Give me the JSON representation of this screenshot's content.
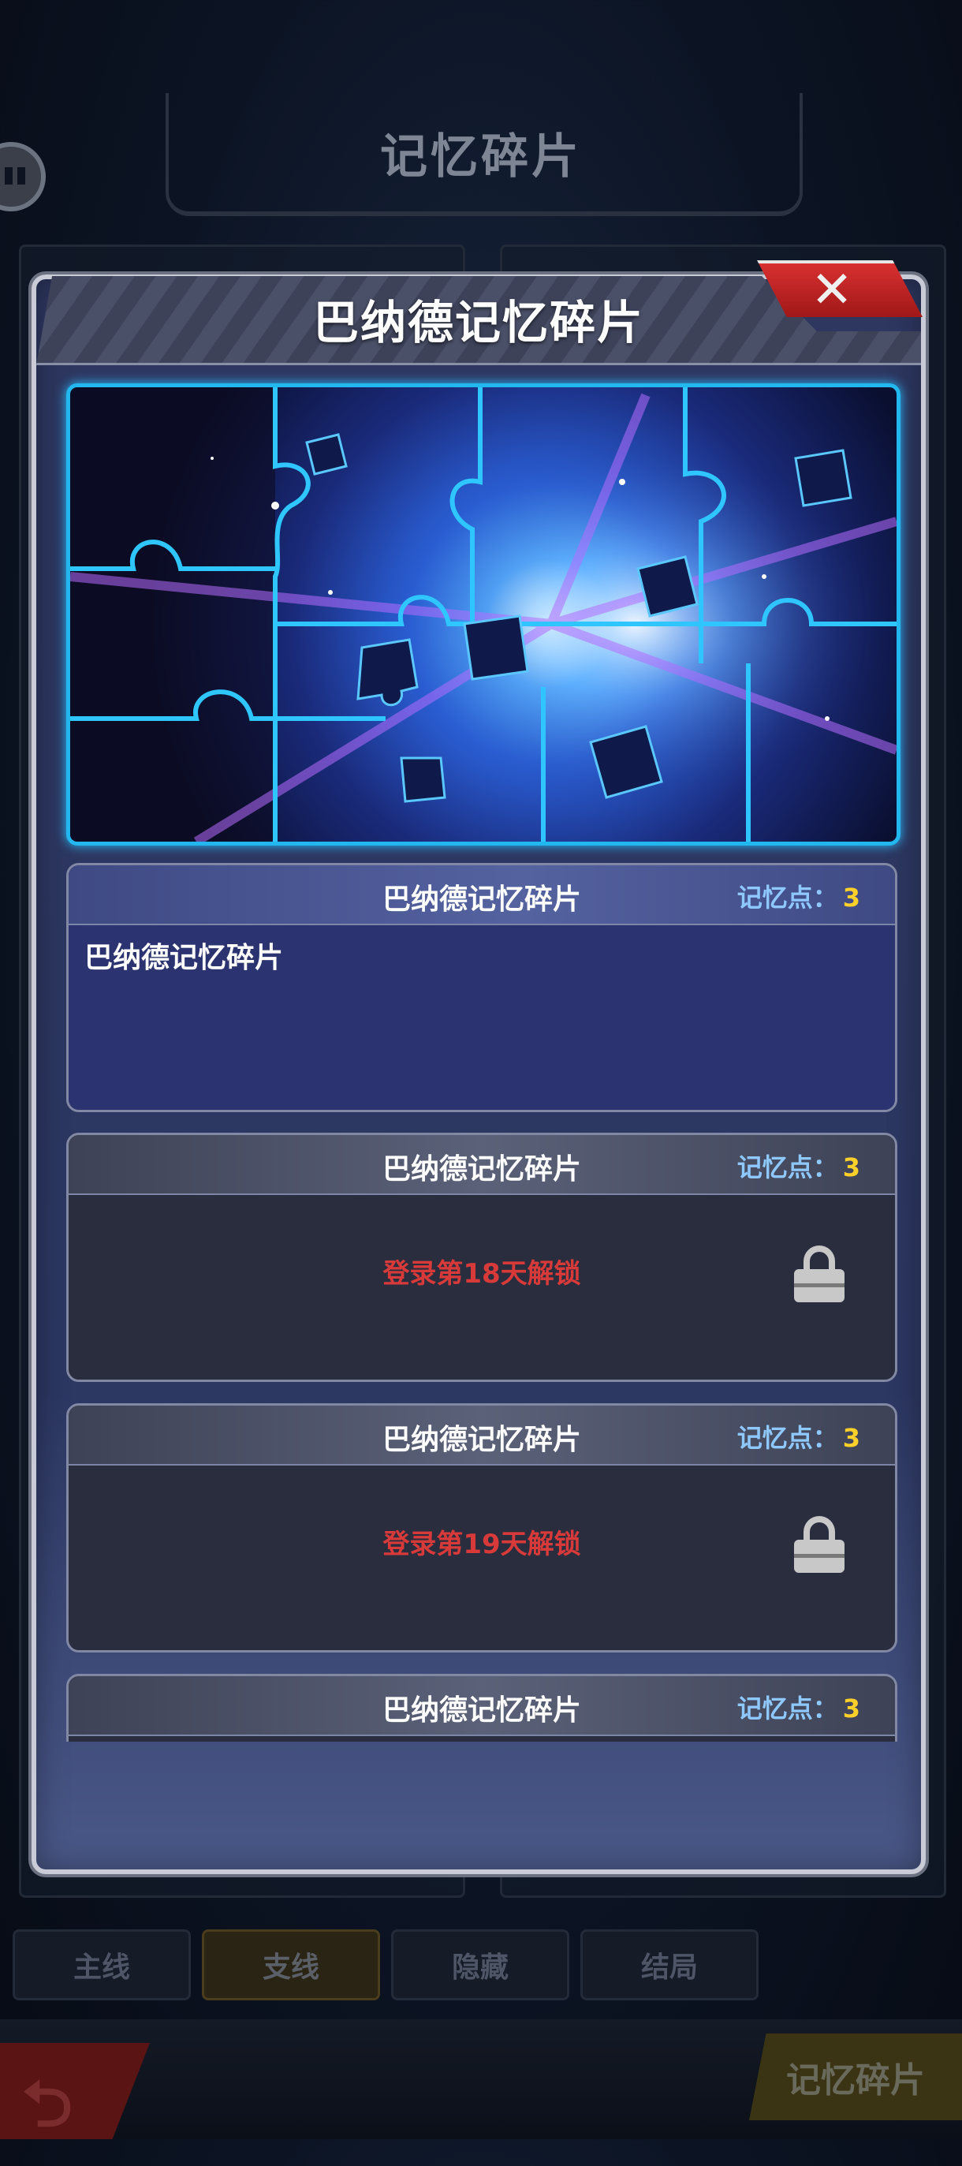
{
  "background": {
    "title": "记忆碎片",
    "tabs": [
      "主线",
      "支线",
      "隐藏",
      "结局"
    ],
    "active_tab_index": 1,
    "bottom_active": "记忆碎片"
  },
  "modal": {
    "title": "巴纳德记忆碎片",
    "close_icon": "close-x-icon",
    "fragments": [
      {
        "name": "巴纳德记忆碎片",
        "points_label": "记忆点：",
        "points": "3",
        "description": "巴纳德记忆碎片",
        "locked": false
      },
      {
        "name": "巴纳德记忆碎片",
        "points_label": "记忆点：",
        "points": "3",
        "unlock_text": "登录第18天解锁",
        "locked": true
      },
      {
        "name": "巴纳德记忆碎片",
        "points_label": "记忆点：",
        "points": "3",
        "unlock_text": "登录第19天解锁",
        "locked": true
      },
      {
        "name": "巴纳德记忆碎片",
        "points_label": "记忆点：",
        "points": "3",
        "locked": true
      }
    ]
  },
  "colors": {
    "accent_blue": "#22b7ee",
    "points_value": "#ffcf2a",
    "points_label": "#8ec8ff",
    "unlock_text": "#d83a3a",
    "close_red": "#d83030"
  }
}
